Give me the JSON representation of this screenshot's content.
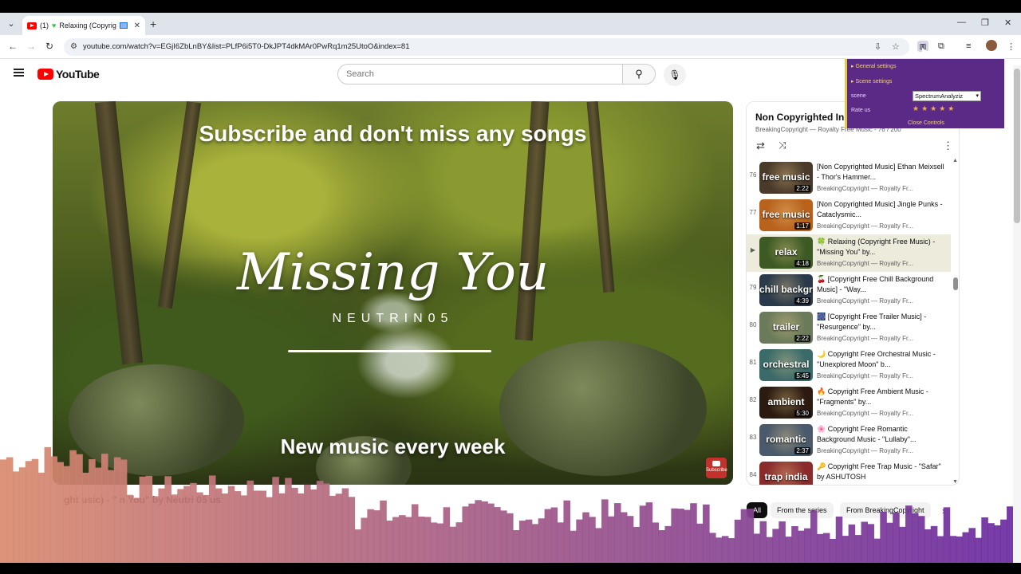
{
  "browser": {
    "tab": {
      "count": "(1)",
      "title": "Relaxing (Copyright"
    },
    "url": "youtube.com/watch?v=EGjI6ZbLnBY&list=PLfP6i5T0-DkJPT4dkMAr0PwRq1m25UtoO&index=81"
  },
  "youtube": {
    "logo_text": "YouTube",
    "search_placeholder": "Search"
  },
  "video": {
    "overlay_top": "Subscribe and don't miss any songs",
    "overlay_title": "Missing You",
    "overlay_artist": "NEUTRIN05",
    "overlay_bottom": "New music every week",
    "subscribe_badge": "Subscribe",
    "title_visible": "ght  usic) - \" n You\" by Neutri 05 us"
  },
  "playlist": {
    "title": "Non Copyrighted In",
    "subtitle": "BreakingCopyright — Royalty Free Music - 76 / 200",
    "items": [
      {
        "index": "76",
        "thumb_word": "free music",
        "duration": "2:22",
        "title": "[Non Copyrighted Music] Ethan Meixsell - Thor's Hammer...",
        "channel": "BreakingCopyright — Royalty Fr...",
        "color": "#4a3a2a"
      },
      {
        "index": "77",
        "thumb_word": "free music",
        "duration": "1:17",
        "title": "[Non Copyrighted Music] Jingle Punks - Cataclysmic...",
        "channel": "BreakingCopyright — Royalty Fr...",
        "color": "#b8621c"
      },
      {
        "index": "",
        "thumb_word": "relax",
        "duration": "4:18",
        "title": "🍀 Relaxing (Copyright Free Music) - \"Missing You\" by...",
        "channel": "BreakingCopyright — Royalty Fr...",
        "color": "#3d5a24",
        "active": true
      },
      {
        "index": "79",
        "thumb_word": "chill background",
        "duration": "4:39",
        "title": "🍒 [Copyright Free Chill Background Music] - \"Way...",
        "channel": "BreakingCopyright — Royalty Fr...",
        "color": "#2b3a4a"
      },
      {
        "index": "80",
        "thumb_word": "trailer",
        "duration": "2:22",
        "title": "🎆 [Copyright Free Trailer Music] - \"Resurgence\" by...",
        "channel": "BreakingCopyright — Royalty Fr...",
        "color": "#6a7a5a"
      },
      {
        "index": "81",
        "thumb_word": "orchestral",
        "duration": "5:45",
        "title": "🌙 Copyright Free Orchestral Music - \"Unexplored Moon\" b...",
        "channel": "BreakingCopyright — Royalty Fr...",
        "color": "#3a6a6a"
      },
      {
        "index": "82",
        "thumb_word": "ambient",
        "duration": "5:30",
        "title": "🔥 Copyright Free Ambient Music - \"Fragments\" by...",
        "channel": "BreakingCopyright — Royalty Fr...",
        "color": "#2a1a10"
      },
      {
        "index": "83",
        "thumb_word": "romantic",
        "duration": "2:37",
        "title": "🌸 Copyright Free Romantic Background Music - \"Lullaby\"...",
        "channel": "BreakingCopyright — Royalty Fr...",
        "color": "#4a5a6a"
      },
      {
        "index": "84",
        "thumb_word": "trap india",
        "duration": "",
        "title": "🔑 Copyright Free Trap Music - \"Safar\" by ASHUTOSH",
        "channel": "",
        "color": "#8a2a2a"
      }
    ]
  },
  "chips": [
    "All",
    "From the series",
    "From BreakingCopyright"
  ],
  "extension_popup": {
    "general": "General settings",
    "scene_settings": "Scene settings",
    "scene_label": "scene",
    "scene_value": "SpectrumAnalyziz",
    "rate_label": "Rate us",
    "stars": "★★★★★",
    "close": "Close Controls"
  },
  "spectrum_colors": {
    "left": "#d98a6e",
    "right": "#6a2aa0"
  }
}
